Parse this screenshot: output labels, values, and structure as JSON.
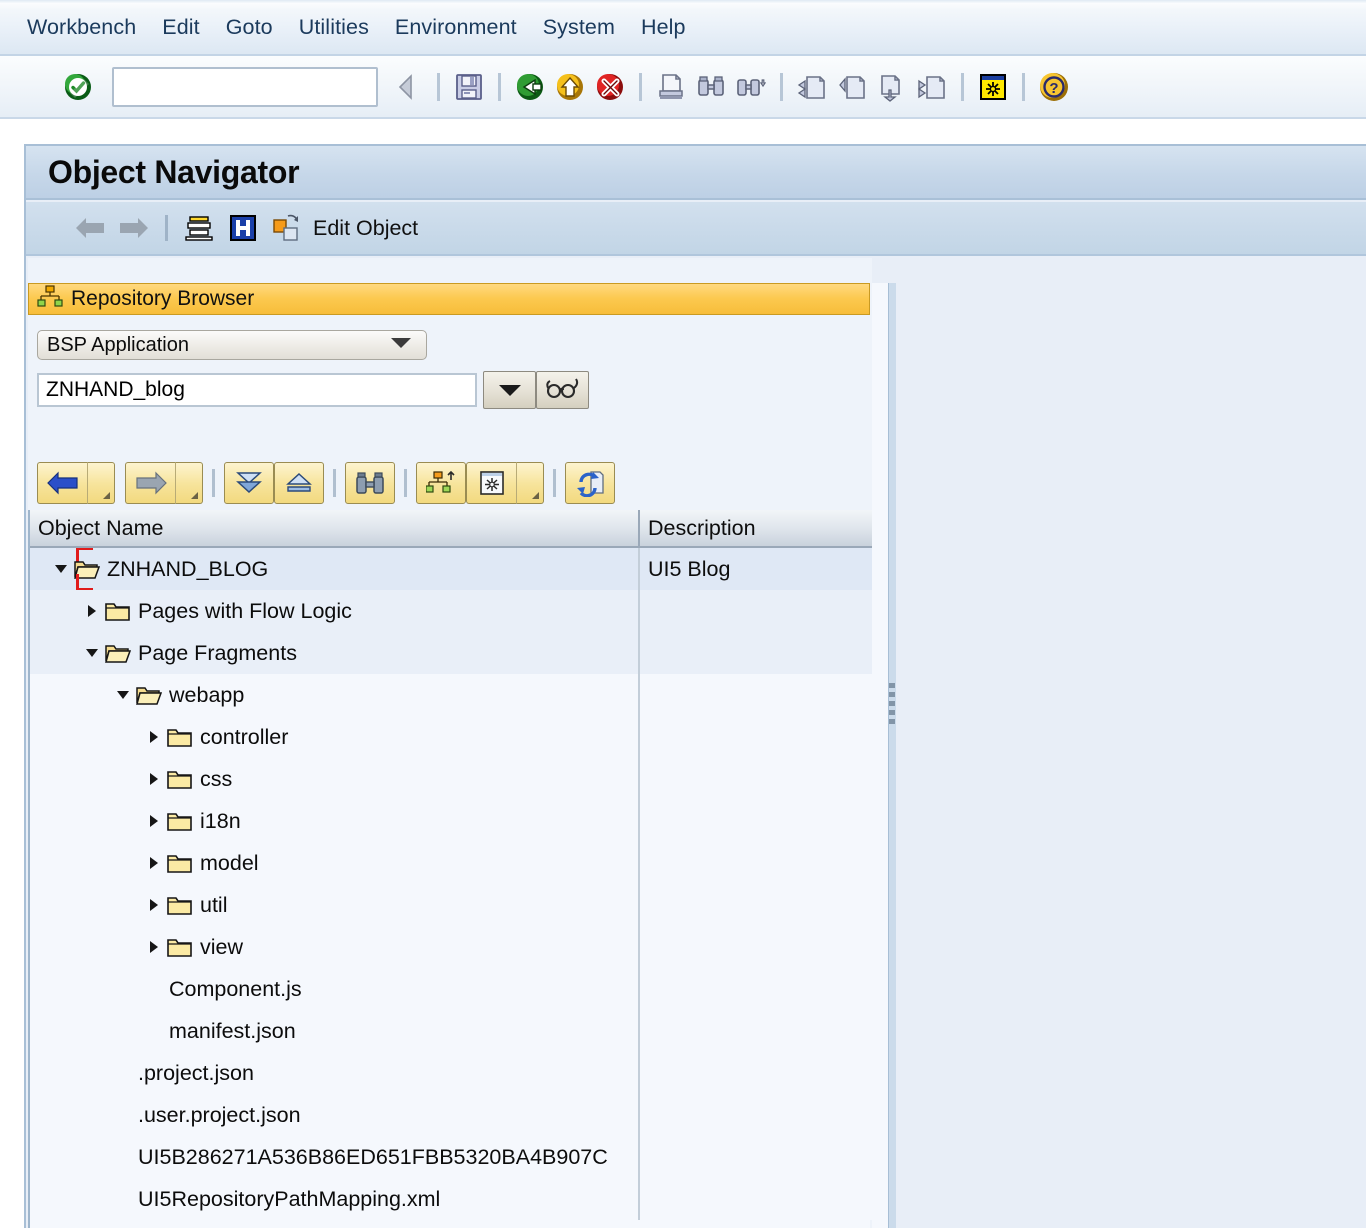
{
  "menubar": {
    "items": [
      {
        "label": "Workbench"
      },
      {
        "label": "Edit"
      },
      {
        "label": "Goto"
      },
      {
        "label": "Utilities"
      },
      {
        "label": "Environment"
      },
      {
        "label": "System"
      },
      {
        "label": "Help"
      }
    ]
  },
  "toolbar": {
    "command_field_value": "",
    "command_field_placeholder": "",
    "icons": [
      "enter-check-icon",
      "back-icon",
      "exit-icon",
      "cancel-icon",
      "print-icon",
      "find-icon",
      "find-next-icon",
      "first-page-icon",
      "previous-page-icon",
      "next-page-icon",
      "last-page-icon",
      "create-session-icon",
      "help-icon"
    ]
  },
  "screen": {
    "title": "Object Navigator"
  },
  "app_toolbar": {
    "back_icon": "arrow-left-icon",
    "forward_icon": "arrow-right-icon",
    "other_object_icon": "other-object-icon",
    "info_icon": "display-info-icon",
    "edit_object_icon": "edit-object-icon",
    "edit_object_label": "Edit Object"
  },
  "repository_browser": {
    "header_label": "Repository Browser",
    "header_icon": "hierarchy-icon",
    "object_type": {
      "selected": "BSP Application",
      "icon": "chevron-down-icon"
    },
    "object_name": {
      "value": "ZNHAND_blog",
      "placeholder": ""
    },
    "dropdown_button_icon": "chevron-down-icon",
    "search_button_icon": "glasses-icon",
    "tools": [
      {
        "name": "tree-back-button",
        "icon": "arrow-left-blue-icon"
      },
      {
        "name": "tree-back-menu-button",
        "icon": "triangle-small-icon"
      },
      {
        "name": "tree-forward-button",
        "icon": "arrow-right-gray-icon"
      },
      {
        "name": "tree-forward-menu-button",
        "icon": "triangle-small-icon"
      },
      {
        "name": "expand-all-button",
        "icon": "expand-all-icon"
      },
      {
        "name": "collapse-all-button",
        "icon": "collapse-all-icon"
      },
      {
        "name": "find-in-tree-button",
        "icon": "binoculars-icon"
      },
      {
        "name": "object-list-button",
        "icon": "object-hierarchy-icon"
      },
      {
        "name": "display-object-button",
        "icon": "display-object-icon"
      },
      {
        "name": "refresh-button",
        "icon": "refresh-icon"
      }
    ]
  },
  "tree": {
    "columns": [
      {
        "key": "name",
        "label": "Object Name"
      },
      {
        "key": "description",
        "label": "Description"
      }
    ],
    "rows": [
      {
        "label": "ZNHAND_BLOG",
        "description": "UI5 Blog",
        "indent": 0,
        "icon": "folder-open-icon",
        "twisty": "down",
        "selected": true,
        "band": "sel"
      },
      {
        "label": "Pages with Flow Logic",
        "description": "",
        "indent": 1,
        "icon": "folder-closed-icon",
        "twisty": "right",
        "selected": false,
        "band": "a"
      },
      {
        "label": "Page Fragments",
        "description": "",
        "indent": 1,
        "icon": "folder-open-icon",
        "twisty": "down",
        "selected": false,
        "band": "a"
      },
      {
        "label": "webapp",
        "description": "",
        "indent": 2,
        "icon": "folder-open-icon",
        "twisty": "down",
        "selected": false,
        "band": "b"
      },
      {
        "label": "controller",
        "description": "",
        "indent": 3,
        "icon": "folder-closed-icon",
        "twisty": "right",
        "selected": false,
        "band": "b"
      },
      {
        "label": "css",
        "description": "",
        "indent": 3,
        "icon": "folder-closed-icon",
        "twisty": "right",
        "selected": false,
        "band": "b"
      },
      {
        "label": "i18n",
        "description": "",
        "indent": 3,
        "icon": "folder-closed-icon",
        "twisty": "right",
        "selected": false,
        "band": "b"
      },
      {
        "label": "model",
        "description": "",
        "indent": 3,
        "icon": "folder-closed-icon",
        "twisty": "right",
        "selected": false,
        "band": "b"
      },
      {
        "label": "util",
        "description": "",
        "indent": 3,
        "icon": "folder-closed-icon",
        "twisty": "right",
        "selected": false,
        "band": "b"
      },
      {
        "label": "view",
        "description": "",
        "indent": 3,
        "icon": "folder-closed-icon",
        "twisty": "right",
        "selected": false,
        "band": "b"
      },
      {
        "label": "Component.js",
        "description": "",
        "indent": 3,
        "icon": "none",
        "twisty": "none",
        "selected": false,
        "band": "b"
      },
      {
        "label": "manifest.json",
        "description": "",
        "indent": 3,
        "icon": "none",
        "twisty": "none",
        "selected": false,
        "band": "b"
      },
      {
        "label": ".project.json",
        "description": "",
        "indent": 2,
        "icon": "none",
        "twisty": "none",
        "selected": false,
        "band": "b"
      },
      {
        "label": ".user.project.json",
        "description": "",
        "indent": 2,
        "icon": "none",
        "twisty": "none",
        "selected": false,
        "band": "b"
      },
      {
        "label": "UI5B286271A536B86ED651FBB5320BA4B907C",
        "description": "",
        "indent": 2,
        "icon": "none",
        "twisty": "none",
        "selected": false,
        "band": "b"
      },
      {
        "label": "UI5RepositoryPathMapping.xml",
        "description": "",
        "indent": 2,
        "icon": "none",
        "twisty": "none",
        "selected": false,
        "band": "b"
      }
    ]
  },
  "colors": {
    "accent_yellow": "#f7bd3a",
    "selection_blue": "#dfe8f5",
    "selection_marker_red": "#e01b1b",
    "panel_blue": "#e8eef7",
    "menu_text": "#1b3a5c"
  }
}
